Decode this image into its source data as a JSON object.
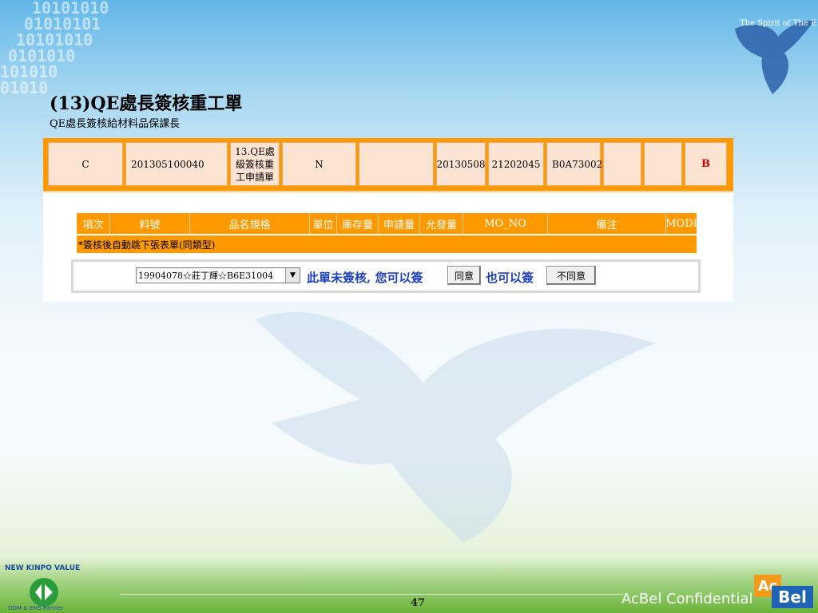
{
  "slide": {
    "title": "(13)QE處長簽核重工單",
    "subtitle": "QE處長簽核給材料品保課長",
    "page_number": "47",
    "confidential": "AcBel Confidential",
    "logo_ac": "Ac",
    "logo_bel": "Bel",
    "eagle_text": "The Spirit of The Eagle",
    "kinpo_text_top": "NEW KINPO VALUE",
    "kinpo_text_bottom": "ODM & EMS Partner",
    "binary_rows": [
      "10101010",
      "01010101",
      "10101010",
      "0101010",
      "101010",
      "01010"
    ]
  },
  "form": {
    "row": {
      "c1": "C",
      "c2": "201305100040",
      "c3_lines": [
        "13.QE處",
        "級簽核重",
        "工申請單"
      ],
      "c4": "N",
      "c5": "",
      "c6": "20130508",
      "c7": "21202045",
      "c8": "B0A73002",
      "c9": "",
      "c10": "",
      "c11": "B"
    },
    "headers": [
      "項次",
      "料號",
      "品名規格",
      "單位",
      "庫存量",
      "申請量",
      "允發量",
      "MO_NO",
      "備注",
      "MODI"
    ],
    "note": "*簽核後自動跳下張表單(同類型)",
    "sign": {
      "selected_signer": "19904078☆莊丁輝☆B6E31004",
      "msg_unsigned": "此單未簽核, 您可以簽",
      "btn_agree": "同意",
      "msg_also": "也可以簽",
      "btn_disagree": "不同意"
    }
  },
  "colors": {
    "orange": "#fe9900",
    "cell_bg": "#fde4d2",
    "sign_text": "#1a3fbf",
    "status_red": "#d40000"
  }
}
